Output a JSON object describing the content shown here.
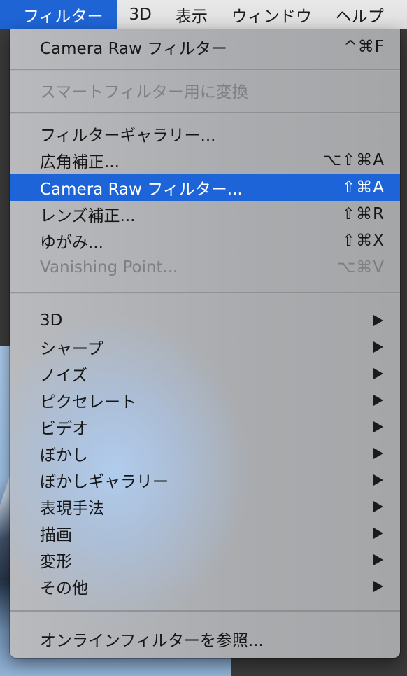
{
  "menubar": {
    "items": [
      {
        "label": "フィルター",
        "active": true
      },
      {
        "label": "3D"
      },
      {
        "label": "表示"
      },
      {
        "label": "ウィンドウ"
      },
      {
        "label": "ヘルプ"
      }
    ]
  },
  "filter_menu": {
    "sections": [
      [
        {
          "label": "Camera Raw フィルター",
          "shortcut": "^⌘F",
          "enabled": true
        }
      ],
      [
        {
          "label": "スマートフィルター用に変換",
          "shortcut": "",
          "enabled": false
        }
      ],
      [
        {
          "label": "フィルターギャラリー...",
          "shortcut": "",
          "enabled": true
        },
        {
          "label": "広角補正...",
          "shortcut": "⌥⇧⌘A",
          "enabled": true
        },
        {
          "label": "Camera Raw フィルター...",
          "shortcut": "⇧⌘A",
          "enabled": true,
          "highlighted": true
        },
        {
          "label": "レンズ補正...",
          "shortcut": "⇧⌘R",
          "enabled": true
        },
        {
          "label": "ゆがみ...",
          "shortcut": "⇧⌘X",
          "enabled": true
        },
        {
          "label": "Vanishing Point...",
          "shortcut": "⌥⌘V",
          "enabled": false
        }
      ],
      [
        {
          "label": "3D",
          "submenu": true
        },
        {
          "label": "シャープ",
          "submenu": true
        },
        {
          "label": "ノイズ",
          "submenu": true
        },
        {
          "label": "ピクセレート",
          "submenu": true
        },
        {
          "label": "ビデオ",
          "submenu": true
        },
        {
          "label": "ぼかし",
          "submenu": true
        },
        {
          "label": "ぼかしギャラリー",
          "submenu": true
        },
        {
          "label": "表現手法",
          "submenu": true
        },
        {
          "label": "描画",
          "submenu": true
        },
        {
          "label": "変形",
          "submenu": true
        },
        {
          "label": "その他",
          "submenu": true
        }
      ],
      [
        {
          "label": "オンラインフィルターを参照...",
          "shortcut": "",
          "enabled": true
        }
      ]
    ]
  },
  "icons": {
    "submenu": "triangle-right-icon"
  },
  "colors": {
    "highlight": "#1d64d8",
    "menubar_bg": "#dcdcdd",
    "disabled_text": "#7e7f82"
  }
}
